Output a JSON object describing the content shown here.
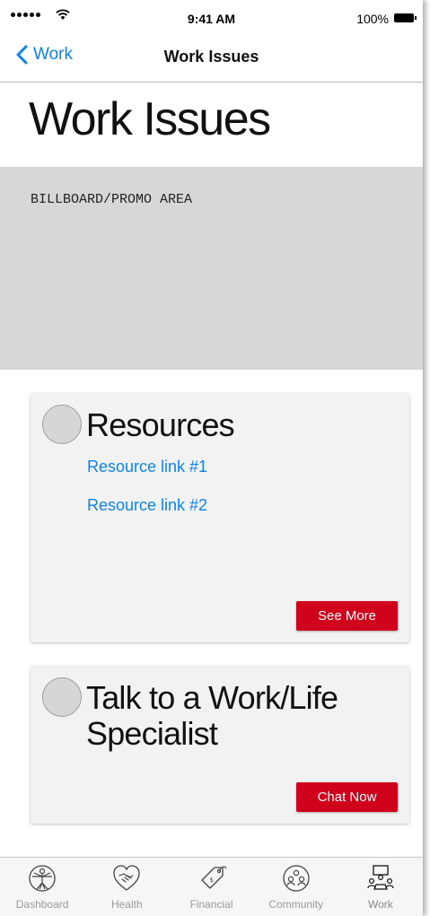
{
  "status_bar": {
    "time": "9:41 AM",
    "battery": "100%"
  },
  "nav": {
    "back_label": "Work",
    "title": "Work Issues"
  },
  "page": {
    "title": "Work Issues"
  },
  "billboard": {
    "label": "BILLBOARD/PROMO AREA"
  },
  "cards": {
    "resources": {
      "title": "Resources",
      "links": [
        "Resource link #1",
        "Resource link #2"
      ],
      "button_label": "See More"
    },
    "specialist": {
      "title": "Talk to a Work/Life Specialist",
      "button_label": "Chat Now"
    }
  },
  "tabs": [
    {
      "label": "Dashboard",
      "icon": "vitruvian-man-icon"
    },
    {
      "label": "Health",
      "icon": "handshake-heart-icon"
    },
    {
      "label": "Financial",
      "icon": "price-tag-icon"
    },
    {
      "label": "Community",
      "icon": "people-circle-icon"
    },
    {
      "label": "Work",
      "icon": "meeting-table-icon"
    }
  ],
  "colors": {
    "accent": "#0b84f0",
    "button": "#d0021b",
    "billboard": "#d7d7d7",
    "card": "#f2f2f2"
  }
}
